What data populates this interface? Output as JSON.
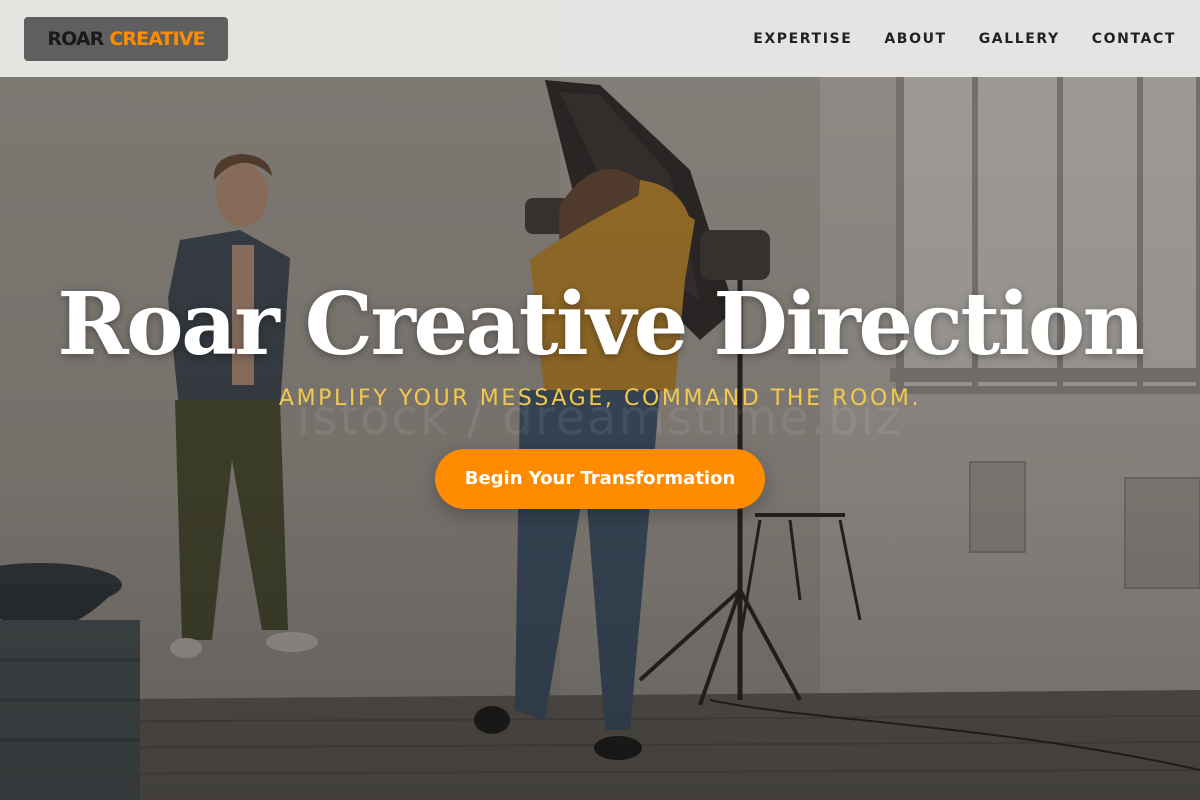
{
  "brand": {
    "part1": "ROAR",
    "part2": "CREATIVE",
    "accent_color": "#ff8c00"
  },
  "nav": {
    "items": [
      {
        "label": "EXPERTISE"
      },
      {
        "label": "ABOUT"
      },
      {
        "label": "GALLERY"
      },
      {
        "label": "CONTACT"
      }
    ]
  },
  "hero": {
    "title": "Roar Creative Direction",
    "subtitle": "AMPLIFY YOUR MESSAGE, COMMAND THE ROOM.",
    "cta_label": "Begin Your Transformation",
    "watermark": "istock / dreamstime.biz",
    "subtitle_color": "#f2c94c",
    "cta_color": "#ff8c00"
  }
}
